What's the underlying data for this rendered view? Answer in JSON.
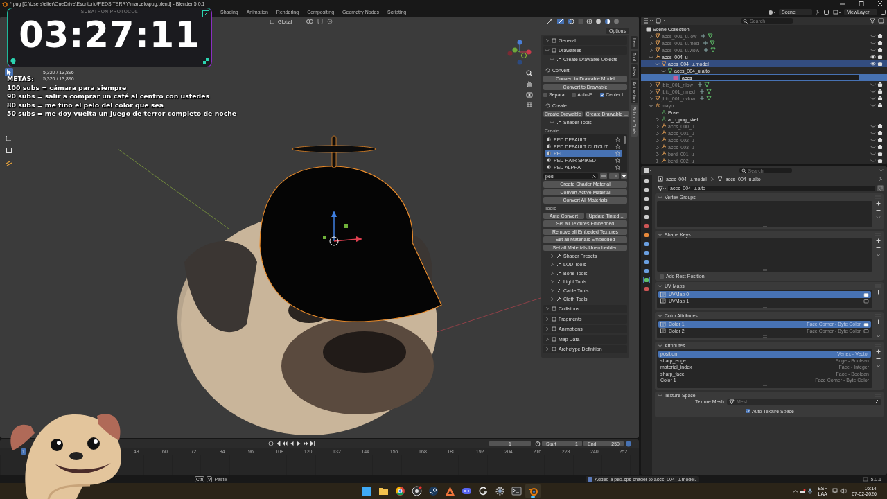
{
  "window": {
    "title": "* pug [C:\\Users\\elter\\OneDrive\\Escritorio\\PEDS TERRY\\marcelo\\pug.blend] - Blender 5.0.1"
  },
  "workspace_tabs": [
    {
      "label": "Shading",
      "selected": false
    },
    {
      "label": "Animation",
      "selected": false
    },
    {
      "label": "Rendering",
      "selected": false
    },
    {
      "label": "Compositing",
      "selected": false
    },
    {
      "label": "Geometry Nodes",
      "selected": false
    },
    {
      "label": "Scripting",
      "selected": false
    }
  ],
  "add_workspace": "+",
  "scene": "Scene",
  "view_layer": "ViewLayer",
  "overlay": {
    "caption": "SUBATHON PROTOCOL",
    "timer": "03:27:11",
    "goals_title": "METAS:",
    "goals": [
      "100 subs = cámara para siempre",
      "90 subs = salir a comprar un café al centro con ustedes",
      "80 subs = me tiño el pelo del color que sea",
      "50 subs = me doy vuelta un juego de terror completo de noche"
    ]
  },
  "viewport": {
    "orientation": "Global",
    "options": "Options",
    "stats": [
      "5,320 / 13,896",
      "5,320 / 13,896"
    ]
  },
  "n_panel": {
    "tabs": [
      {
        "label": "Item",
        "selected": false
      },
      {
        "label": "Tool",
        "selected": false
      },
      {
        "label": "View",
        "selected": false
      },
      {
        "label": "Animation",
        "selected": false
      },
      {
        "label": "Sollumz Tools",
        "selected": true
      }
    ],
    "rows": [
      {
        "kind": "panel",
        "label": "General",
        "expanded": false
      },
      {
        "kind": "panel",
        "label": "Drawables",
        "expanded": true
      },
      {
        "kind": "subpanel",
        "label": "Create Drawable Objects",
        "expanded": true
      },
      {
        "kind": "heading",
        "label": "Convert"
      },
      {
        "kind": "button",
        "label": "Convert to Drawable Model"
      },
      {
        "kind": "button",
        "label": "Convert to Drawable"
      },
      {
        "kind": "checks",
        "items": [
          {
            "label": "Separat...",
            "checked": false
          },
          {
            "label": "Auto-E...",
            "checked": false
          },
          {
            "label": "Center t...",
            "checked": true
          }
        ]
      },
      {
        "kind": "heading",
        "label": "Create"
      },
      {
        "kind": "buttons",
        "items": [
          "Create Drawable",
          "Create Drawable ..."
        ]
      },
      {
        "kind": "subpanel",
        "label": "Shader Tools",
        "expanded": true
      },
      {
        "kind": "label",
        "label": "Create"
      },
      {
        "kind": "list",
        "items": [
          {
            "label": "PED DEFAULT",
            "selected": false
          },
          {
            "label": "PED DEFAULT CUTOUT",
            "selected": false
          },
          {
            "label": "PED",
            "selected": true
          },
          {
            "label": "PED HAIR SPIKED",
            "selected": false
          },
          {
            "label": "PED ALPHA",
            "selected": false
          }
        ]
      },
      {
        "kind": "filter",
        "value": "ped"
      },
      {
        "kind": "button",
        "label": "Create Shader Material"
      },
      {
        "kind": "button",
        "label": "Convert Active Material"
      },
      {
        "kind": "button",
        "label": "Convert All Materials"
      },
      {
        "kind": "label",
        "label": "Tools"
      },
      {
        "kind": "buttons",
        "items": [
          "Auto Convert",
          "Update Tinted ..."
        ]
      },
      {
        "kind": "button",
        "label": "Set all Textures Embedded"
      },
      {
        "kind": "button",
        "label": "Remove all Embeded Textures"
      },
      {
        "kind": "button",
        "label": "Set all Materials Embedded"
      },
      {
        "kind": "button",
        "label": "Set all Materials Unembedded"
      },
      {
        "kind": "subpanel",
        "label": "Shader Presets",
        "expanded": false
      },
      {
        "kind": "subpanel",
        "label": "LOD Tools",
        "expanded": false
      },
      {
        "kind": "subpanel",
        "label": "Bone Tools",
        "expanded": false
      },
      {
        "kind": "subpanel",
        "label": "Light Tools",
        "expanded": false
      },
      {
        "kind": "subpanel",
        "label": "Cable Tools",
        "expanded": false
      },
      {
        "kind": "subpanel",
        "label": "Cloth Tools",
        "expanded": false
      },
      {
        "kind": "panel",
        "label": "Collisions",
        "expanded": false
      },
      {
        "kind": "panel",
        "label": "Fragments",
        "expanded": false
      },
      {
        "kind": "panel",
        "label": "Animations",
        "expanded": false
      },
      {
        "kind": "panel",
        "label": "Map Data",
        "expanded": false
      },
      {
        "kind": "panel",
        "label": "Archetype Definition",
        "expanded": false
      }
    ]
  },
  "outliner": {
    "search_placeholder": "Search",
    "root": "Scene Collection",
    "rows": [
      {
        "kind": "mesh_object",
        "label": "accs_001_u.low",
        "expanded": false,
        "visible": false,
        "selected": false
      },
      {
        "kind": "mesh_object",
        "label": "accs_001_u.med",
        "expanded": false,
        "visible": false,
        "selected": false
      },
      {
        "kind": "mesh_object",
        "label": "accs_001_u.vlow",
        "expanded": false,
        "visible": false,
        "selected": false
      },
      {
        "kind": "armature",
        "label": "accs_004_u",
        "expanded": true,
        "visible": true,
        "selected": false,
        "children": [
          {
            "kind": "mesh_object",
            "label": "accs_004_u.model",
            "expanded": true,
            "visible": true,
            "selected": true,
            "children": [
              {
                "kind": "mesh_data",
                "label": "accs_004_u.alto",
                "expanded": true,
                "selected": false,
                "children": [
                  {
                    "kind": "rename",
                    "value": "accs"
                  }
                ]
              }
            ]
          }
        ]
      },
      {
        "kind": "mesh_object",
        "label": "jbib_001_r.low",
        "expanded": false,
        "visible": false,
        "selected": false
      },
      {
        "kind": "mesh_object",
        "label": "jbib_001_r.med",
        "expanded": false,
        "visible": false,
        "selected": false
      },
      {
        "kind": "mesh_object",
        "label": "jbib_001_r.vlow",
        "expanded": false,
        "visible": false,
        "selected": false
      },
      {
        "kind": "skeleton",
        "label": "mayo",
        "expanded": true,
        "visible": false,
        "selected": false,
        "children": [
          {
            "kind": "pose",
            "label": "Pose",
            "selected": false
          },
          {
            "kind": "armature_data",
            "label": "a_c_pug_skel",
            "expanded": false,
            "selected": false
          },
          {
            "kind": "armature",
            "label": "accs_000_u",
            "expanded": false,
            "visible": false,
            "selected": false
          },
          {
            "kind": "armature",
            "label": "accs_001_u",
            "expanded": false,
            "visible": false,
            "selected": false
          },
          {
            "kind": "armature",
            "label": "accs_002_u",
            "expanded": false,
            "visible": false,
            "selected": false
          },
          {
            "kind": "armature",
            "label": "accs_003_u",
            "expanded": false,
            "visible": false,
            "selected": false
          },
          {
            "kind": "armature",
            "label": "berd_001_u",
            "expanded": false,
            "visible": false,
            "selected": false
          },
          {
            "kind": "armature",
            "label": "berd_002_u",
            "expanded": false,
            "visible": false,
            "selected": false
          }
        ]
      }
    ]
  },
  "properties": {
    "search_placeholder": "Search",
    "breadcrumb": [
      "accs_004_u.model",
      "accs_004_u.alto"
    ],
    "data_name": "accs_004_u.alto",
    "panels": [
      {
        "kind": "empty_list",
        "title": "Vertex Groups"
      },
      {
        "kind": "empty_list",
        "title": "Shape Keys",
        "checkbox": {
          "label": "Add Rest Position",
          "checked": false
        }
      },
      {
        "kind": "list",
        "title": "UV Maps",
        "items": [
          {
            "name": "UVMap 0",
            "selected": true
          },
          {
            "name": "UVMap 1",
            "selected": false
          }
        ]
      },
      {
        "kind": "list",
        "title": "Color Attributes",
        "items": [
          {
            "name": "Color 1",
            "detail": "Face Corner - Byte Color",
            "selected": true
          },
          {
            "name": "Color 2",
            "detail": "Face Corner - Byte Color",
            "selected": false
          }
        ]
      },
      {
        "kind": "list",
        "title": "Attributes",
        "items": [
          {
            "name": "position",
            "detail": "Vertex - Vector",
            "selected": true
          },
          {
            "name": "sharp_edge",
            "detail": "Edge - Boolean",
            "selected": false
          },
          {
            "name": "material_index",
            "detail": "Face - Integer",
            "selected": false
          },
          {
            "name": "sharp_face",
            "detail": "Face - Boolean",
            "selected": false
          },
          {
            "name": "Color 1",
            "detail": "Face Corner - Byte Color",
            "selected": false
          }
        ]
      },
      {
        "kind": "texture_space",
        "title": "Texture Space",
        "field_label": "Texture Mesh",
        "placeholder": "Mesh",
        "checkbox": {
          "label": "Auto Texture Space",
          "checked": true
        }
      }
    ]
  },
  "timeline": {
    "current_frame": "1",
    "start_label": "Start",
    "start": "1",
    "end_label": "End",
    "end": "250",
    "playhead": "1",
    "ruler": [
      "48",
      "60",
      "72",
      "84",
      "96",
      "108",
      "120",
      "132",
      "144",
      "156",
      "168",
      "180",
      "192",
      "204",
      "216",
      "228",
      "240",
      "252"
    ]
  },
  "status_bar": {
    "keys": [
      "Ctrl",
      "V"
    ],
    "hint": "Paste",
    "message": "Added a ped.sps shader to accs_004_u.model.",
    "version": "5.0.1"
  },
  "taskbar": {
    "apps": [
      {
        "kind": "start",
        "active": false
      },
      {
        "kind": "folder",
        "active": false
      },
      {
        "kind": "browser",
        "active": false
      },
      {
        "kind": "recorder",
        "active": false
      },
      {
        "kind": "steam",
        "active": false
      },
      {
        "kind": "launcher",
        "active": false
      },
      {
        "kind": "chat",
        "active": false
      },
      {
        "kind": "logitech",
        "active": false
      },
      {
        "kind": "settings",
        "active": false
      },
      {
        "kind": "terminal",
        "active": false
      },
      {
        "kind": "blender",
        "active": true
      }
    ],
    "language": "ESP",
    "layout": "LAA",
    "time": "16:14",
    "date": "07-02-2026"
  }
}
